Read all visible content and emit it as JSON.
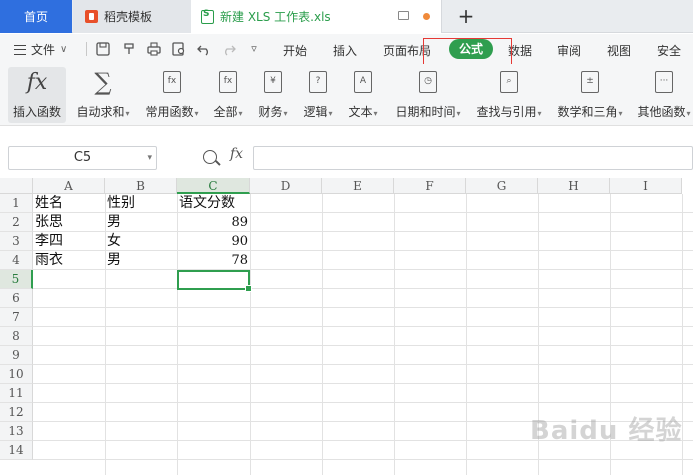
{
  "tabs": {
    "home": "首页",
    "template": "稻壳模板",
    "file": "新建 XLS 工作表.xls",
    "add": "+"
  },
  "menu": {
    "file": "文件",
    "file_chevron": "∨",
    "more": "▿",
    "items": [
      "开始",
      "插入",
      "页面布局",
      "公式",
      "数据",
      "审阅",
      "视图",
      "安全"
    ],
    "active": "公式"
  },
  "ribbon": {
    "insert_function": "插入函数",
    "autosum": "自动求和",
    "common_functions": "常用函数",
    "all": "全部",
    "finance": "财务",
    "logic": "逻辑",
    "text": "文本",
    "datetime": "日期和时间",
    "lookup": "查找与引用",
    "math": "数学和三角",
    "other": "其他函数",
    "dropdown": "▾"
  },
  "formula_bar": {
    "cell_ref": "C5",
    "fx": "fx",
    "formula": ""
  },
  "sheet": {
    "columns": [
      "A",
      "B",
      "C",
      "D",
      "E",
      "F",
      "G",
      "H",
      "I"
    ],
    "selected_column": "C",
    "rows": [
      "1",
      "2",
      "3",
      "4",
      "5",
      "6",
      "7",
      "8",
      "9",
      "10",
      "11",
      "12",
      "13",
      "14"
    ],
    "selected_row": "5",
    "header": [
      "姓名",
      "性别",
      "语文分数"
    ],
    "data": [
      [
        "张思",
        "男",
        "89"
      ],
      [
        "李四",
        "女",
        "90"
      ],
      [
        "雨衣",
        "男",
        "78"
      ]
    ]
  },
  "watermark": "Baidu 经验",
  "colors": {
    "accent_green": "#2f9e4f",
    "home_tab_blue": "#2f6fdf",
    "highlight_red": "#e53935"
  }
}
